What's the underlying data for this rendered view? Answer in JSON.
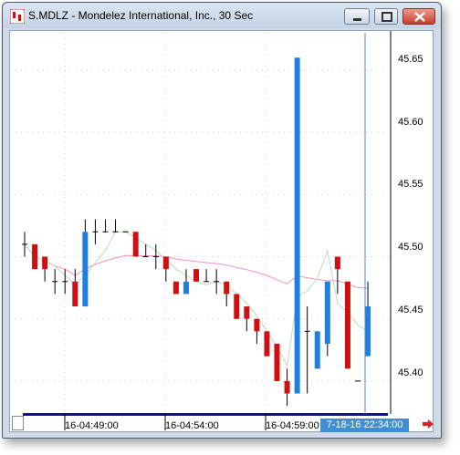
{
  "window": {
    "title": "S.MDLZ - Mondelez International, Inc., 30 Sec"
  },
  "chart_data": {
    "type": "candlestick",
    "y_ticks": [
      "45.65",
      "45.60",
      "45.55",
      "45.50",
      "45.45",
      "45.40"
    ],
    "ylim": [
      45.375,
      45.68
    ],
    "time_labels": [
      "16-04:49:00",
      "16-04:54:00",
      "16-04:59:00"
    ],
    "cursor_time": "7-18-16 22:34:00",
    "colors": {
      "up": "#1e7fdf",
      "down": "#d01010",
      "doji": "#000000",
      "ma_fast": "#b8dcb8",
      "ma_slow": "#f090c8",
      "cursor": "#3d8fd9"
    },
    "candles": [
      {
        "o": 45.51,
        "h": 45.52,
        "l": 45.5,
        "c": 45.51
      },
      {
        "o": 45.51,
        "h": 45.51,
        "l": 45.49,
        "c": 45.49
      },
      {
        "o": 45.5,
        "h": 45.5,
        "l": 45.48,
        "c": 45.49
      },
      {
        "o": 45.48,
        "h": 45.49,
        "l": 45.47,
        "c": 45.48
      },
      {
        "o": 45.48,
        "h": 45.49,
        "l": 45.47,
        "c": 45.48
      },
      {
        "o": 45.48,
        "h": 45.49,
        "l": 45.46,
        "c": 45.46
      },
      {
        "o": 45.46,
        "h": 45.53,
        "l": 45.46,
        "c": 45.52
      },
      {
        "o": 45.52,
        "h": 45.53,
        "l": 45.51,
        "c": 45.52
      },
      {
        "o": 45.52,
        "h": 45.53,
        "l": 45.52,
        "c": 45.52
      },
      {
        "o": 45.52,
        "h": 45.53,
        "l": 45.52,
        "c": 45.52
      },
      {
        "o": 45.52,
        "h": 45.52,
        "l": 45.52,
        "c": 45.52
      },
      {
        "o": 45.52,
        "h": 45.52,
        "l": 45.5,
        "c": 45.5
      },
      {
        "o": 45.5,
        "h": 45.51,
        "l": 45.5,
        "c": 45.5
      },
      {
        "o": 45.5,
        "h": 45.51,
        "l": 45.49,
        "c": 45.5
      },
      {
        "o": 45.5,
        "h": 45.5,
        "l": 45.48,
        "c": 45.49
      },
      {
        "o": 45.48,
        "h": 45.48,
        "l": 45.47,
        "c": 45.47
      },
      {
        "o": 45.47,
        "h": 45.49,
        "l": 45.47,
        "c": 45.48
      },
      {
        "o": 45.49,
        "h": 45.49,
        "l": 45.48,
        "c": 45.48
      },
      {
        "o": 45.48,
        "h": 45.49,
        "l": 45.48,
        "c": 45.48
      },
      {
        "o": 45.48,
        "h": 45.49,
        "l": 45.47,
        "c": 45.48
      },
      {
        "o": 45.48,
        "h": 45.48,
        "l": 45.46,
        "c": 45.47
      },
      {
        "o": 45.47,
        "h": 45.47,
        "l": 45.45,
        "c": 45.45
      },
      {
        "o": 45.46,
        "h": 45.46,
        "l": 45.44,
        "c": 45.45
      },
      {
        "o": 45.45,
        "h": 45.45,
        "l": 45.43,
        "c": 45.44
      },
      {
        "o": 45.44,
        "h": 45.44,
        "l": 45.42,
        "c": 45.42
      },
      {
        "o": 45.43,
        "h": 45.43,
        "l": 45.4,
        "c": 45.4
      },
      {
        "o": 45.4,
        "h": 45.41,
        "l": 45.38,
        "c": 45.39
      },
      {
        "o": 45.39,
        "h": 45.66,
        "l": 45.39,
        "c": 45.66
      },
      {
        "o": 45.44,
        "h": 45.46,
        "l": 45.39,
        "c": 45.44
      },
      {
        "o": 45.41,
        "h": 45.44,
        "l": 45.41,
        "c": 45.44
      },
      {
        "o": 45.43,
        "h": 45.48,
        "l": 45.42,
        "c": 45.48
      },
      {
        "o": 45.5,
        "h": 45.5,
        "l": 45.47,
        "c": 45.49
      },
      {
        "o": 45.48,
        "h": 45.48,
        "l": 45.41,
        "c": 45.41
      },
      {
        "o": 45.4,
        "h": 45.4,
        "l": 45.4,
        "c": 45.4
      },
      {
        "o": 45.42,
        "h": 45.48,
        "l": 45.42,
        "c": 45.46
      }
    ]
  }
}
